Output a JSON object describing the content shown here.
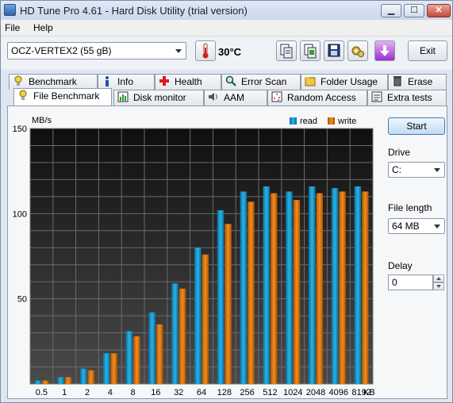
{
  "window": {
    "title": "HD Tune Pro 4.61 - Hard Disk Utility (trial version)",
    "min_glyph": "▁",
    "max_glyph": "☐",
    "close_glyph": "✕"
  },
  "menu": {
    "file": "File",
    "help": "Help"
  },
  "toolbar": {
    "drive": "OCZ-VERTEX2 (55 gB)",
    "temperature": "30°C",
    "exit_label": "Exit",
    "icons": [
      "copy-info-icon",
      "copy-screenshot-icon",
      "save-icon",
      "options-icon",
      "download-icon"
    ]
  },
  "tabs_row1": [
    {
      "label": "Benchmark",
      "icon": "benchmark-icon"
    },
    {
      "label": "Info",
      "icon": "info-icon"
    },
    {
      "label": "Health",
      "icon": "health-icon"
    },
    {
      "label": "Error Scan",
      "icon": "error-scan-icon"
    },
    {
      "label": "Folder Usage",
      "icon": "folder-icon"
    },
    {
      "label": "Erase",
      "icon": "erase-icon"
    }
  ],
  "tabs_row2": [
    {
      "label": "File Benchmark",
      "icon": "file-benchmark-icon",
      "active": true
    },
    {
      "label": "Disk monitor",
      "icon": "disk-monitor-icon"
    },
    {
      "label": "AAM",
      "icon": "speaker-icon"
    },
    {
      "label": "Random Access",
      "icon": "random-access-icon"
    },
    {
      "label": "Extra tests",
      "icon": "extra-tests-icon"
    }
  ],
  "side": {
    "start_label": "Start",
    "drive_label": "Drive",
    "drive_value": "C:",
    "file_length_label": "File length",
    "file_length_value": "64 MB",
    "delay_label": "Delay",
    "delay_value": "0"
  },
  "chart_data": {
    "type": "bar",
    "ylabel": "MB/s",
    "xunit": "KB",
    "ylim": [
      0,
      150
    ],
    "yticks": [
      "50",
      "100",
      "150"
    ],
    "categories": [
      "0.5",
      "1",
      "2",
      "4",
      "8",
      "16",
      "32",
      "64",
      "128",
      "256",
      "512",
      "1024",
      "2048",
      "4096",
      "8192"
    ],
    "legend_position": "top-right",
    "series": [
      {
        "name": "read",
        "color": "#1a9bd0",
        "values": [
          2,
          4,
          9,
          18,
          31,
          42,
          59,
          80,
          102,
          113,
          116,
          113,
          116,
          115,
          116
        ]
      },
      {
        "name": "write",
        "color": "#e07a0f",
        "values": [
          2,
          4,
          8,
          18,
          28,
          35,
          56,
          76,
          94,
          107,
          112,
          108,
          112,
          113,
          113
        ]
      }
    ]
  }
}
